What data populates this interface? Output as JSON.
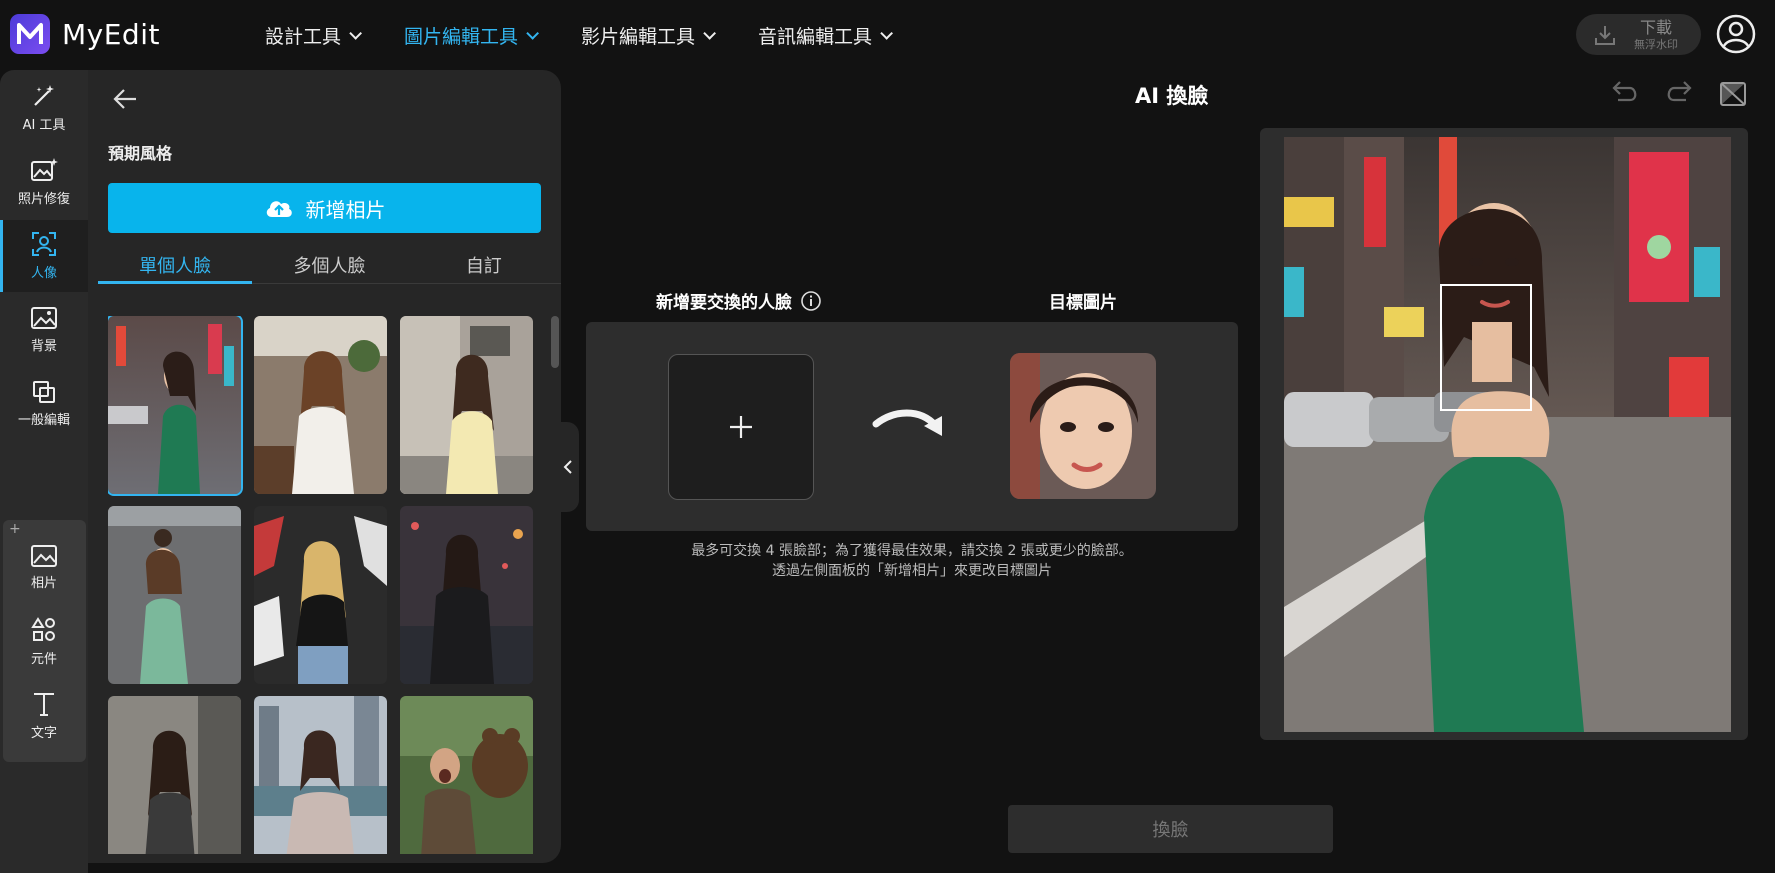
{
  "app": {
    "name": "MyEdit"
  },
  "nav": {
    "items": [
      {
        "label": "設計工具",
        "active": false
      },
      {
        "label": "圖片編輯工具",
        "active": true
      },
      {
        "label": "影片編輯工具",
        "active": false
      },
      {
        "label": "音訊編輯工具",
        "active": false
      }
    ]
  },
  "download": {
    "label": "下載",
    "sub": "無浮水印"
  },
  "rail": {
    "items": [
      {
        "label": "AI 工具",
        "icon": "magic-wand-icon"
      },
      {
        "label": "照片修復",
        "icon": "photo-enhance-icon"
      },
      {
        "label": "人像",
        "icon": "portrait-icon",
        "active": true
      },
      {
        "label": "背景",
        "icon": "background-icon"
      },
      {
        "label": "一般編輯",
        "icon": "crop-icon"
      },
      {
        "label": "相片",
        "icon": "photo-icon"
      },
      {
        "label": "元件",
        "icon": "shapes-icon"
      },
      {
        "label": "文字",
        "icon": "text-icon"
      }
    ]
  },
  "panel": {
    "title": "預期風格",
    "add_photo_label": "新增相片",
    "tabs": [
      {
        "label": "單個人臉",
        "active": true
      },
      {
        "label": "多個人臉",
        "active": false
      },
      {
        "label": "自訂",
        "active": false
      }
    ]
  },
  "main": {
    "title": "AI 換臉",
    "faces_label": "新增要交換的人臉",
    "target_label": "目標圖片",
    "hint_line1": "最多可交換 4 張臉部；為了獲得最佳效果，請交換 2 張或更少的臉部。",
    "hint_line2": "透過左側面板的「新增相片」來更改目標圖片",
    "swap_button": "換臉"
  },
  "colors": {
    "accent": "#33b5f0",
    "primary_button": "#08b4ec"
  }
}
